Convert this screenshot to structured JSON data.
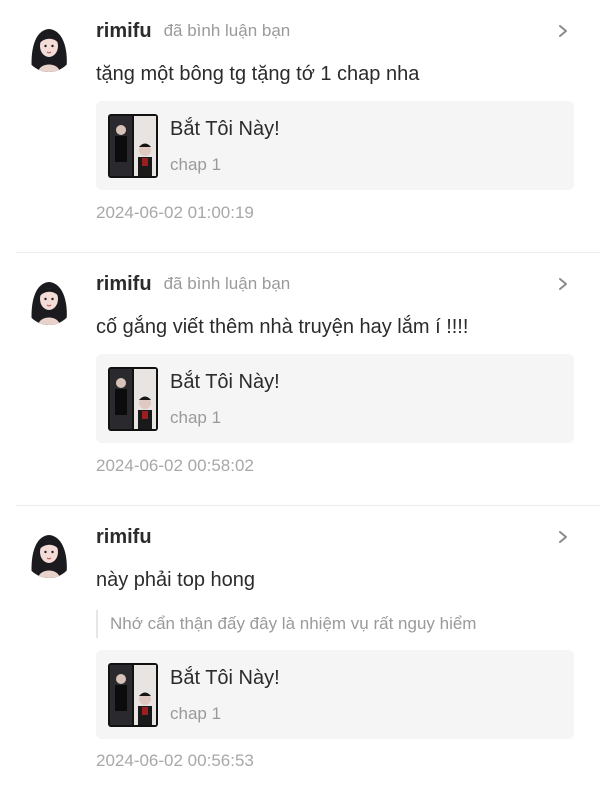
{
  "notifications": [
    {
      "username": "rimifu",
      "action": "đã bình luận bạn",
      "content": "tặng một bông tg tặng tớ 1 chap nha",
      "quote": "",
      "story_title": "Bắt Tôi Này!",
      "chapter": "chap 1",
      "timestamp": "2024-06-02 01:00:19"
    },
    {
      "username": "rimifu",
      "action": "đã bình luận bạn",
      "content": "cố gắng viết thêm nhà truyện hay lắm í !!!!",
      "quote": "",
      "story_title": "Bắt Tôi Này!",
      "chapter": "chap 1",
      "timestamp": "2024-06-02 00:58:02"
    },
    {
      "username": "rimifu",
      "action": "",
      "content": "này phải top hong",
      "quote": "Nhớ cẩn thận đấy đây là nhiệm vụ rất nguy hiểm",
      "story_title": "Bắt Tôi Này!",
      "chapter": "chap 1",
      "timestamp": "2024-06-02 00:56:53"
    }
  ],
  "icons": {
    "avatar": "user-avatar-icon",
    "chevron": "chevron-right-icon",
    "cover": "story-cover-thumbnail"
  },
  "colors": {
    "text": "#2b2b2b",
    "muted": "#9a9a9a",
    "card_bg": "#f5f5f5",
    "divider": "#ececec"
  }
}
